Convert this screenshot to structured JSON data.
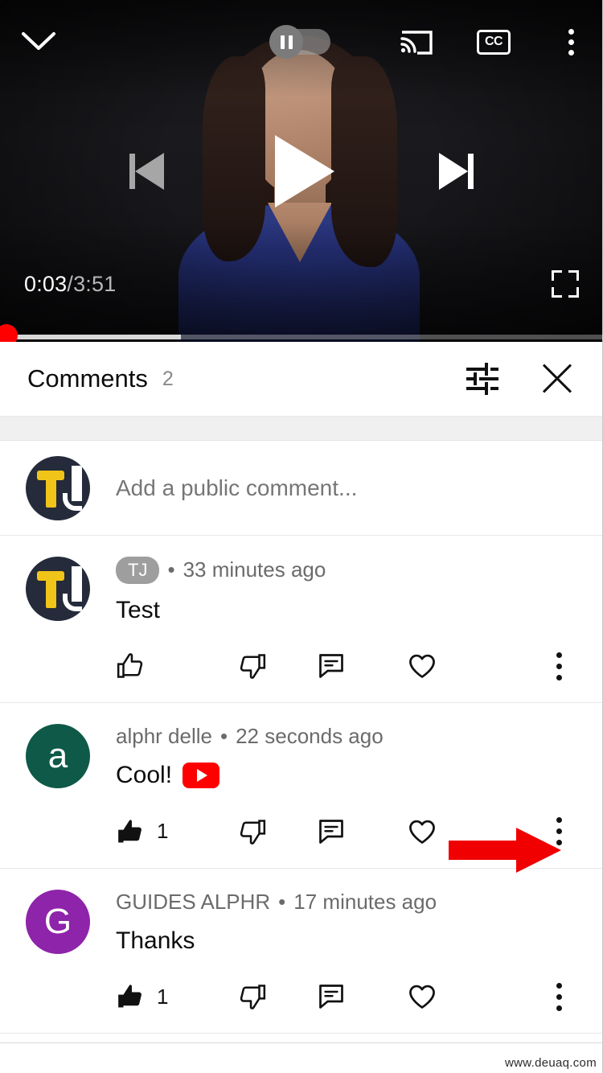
{
  "player": {
    "collapse_icon": "chevron-down-icon",
    "autoplay": {
      "label": "Autoplay",
      "state": "paused",
      "icon": "pause-icon"
    },
    "cast_icon": "cast-icon",
    "captions_label": "CC",
    "more_icon": "more-vertical-icon",
    "previous_icon": "skip-previous-icon",
    "play_icon": "play-icon",
    "next_icon": "skip-next-icon",
    "current_time": "0:03",
    "time_separator": "/",
    "total_time": "3:51",
    "fullscreen_icon": "fullscreen-icon",
    "progress": {
      "played_percent": 1,
      "buffered_percent": 30,
      "accent_color": "#ff0000"
    }
  },
  "comments": {
    "title": "Comments",
    "count": "2",
    "sort_icon": "sort-filter-icon",
    "close_icon": "close-icon",
    "add_comment": {
      "placeholder": "Add a public comment...",
      "avatar": {
        "type": "tj-logo",
        "bg": "#252b3a",
        "letter_colors": [
          "#f0c419",
          "#ffffff"
        ]
      }
    },
    "items": [
      {
        "avatar": {
          "type": "tj-logo",
          "bg": "#252b3a",
          "letter": ""
        },
        "badge": "TJ",
        "author": "",
        "dot": "•",
        "time": "33 minutes ago",
        "text": "Test",
        "has_yt_emoji": false,
        "like_count": "",
        "liked": false,
        "actions": [
          "like-icon",
          "dislike-icon",
          "reply-icon",
          "heart-icon",
          "more-vertical-icon"
        ]
      },
      {
        "avatar": {
          "type": "letter",
          "bg": "#0e5948",
          "letter": "a"
        },
        "badge": "",
        "author": "alphr delle",
        "dot": "•",
        "time": "22 seconds ago",
        "text": "Cool!",
        "has_yt_emoji": true,
        "like_count": "1",
        "liked": true,
        "actions": [
          "like-icon",
          "dislike-icon",
          "reply-icon",
          "heart-icon",
          "more-vertical-icon"
        ]
      },
      {
        "avatar": {
          "type": "letter",
          "bg": "#8e24aa",
          "letter": "G"
        },
        "badge": "",
        "author": "GUIDES ALPHR",
        "dot": "•",
        "time": "17 minutes ago",
        "text": "Thanks",
        "has_yt_emoji": false,
        "like_count": "1",
        "liked": true,
        "actions": [
          "like-icon",
          "dislike-icon",
          "reply-icon",
          "heart-icon",
          "more-vertical-icon"
        ]
      }
    ]
  },
  "annotation": {
    "arrow_color": "#f00000",
    "points_to": "comment-2-more-menu"
  },
  "watermark": "www.deuaq.com"
}
